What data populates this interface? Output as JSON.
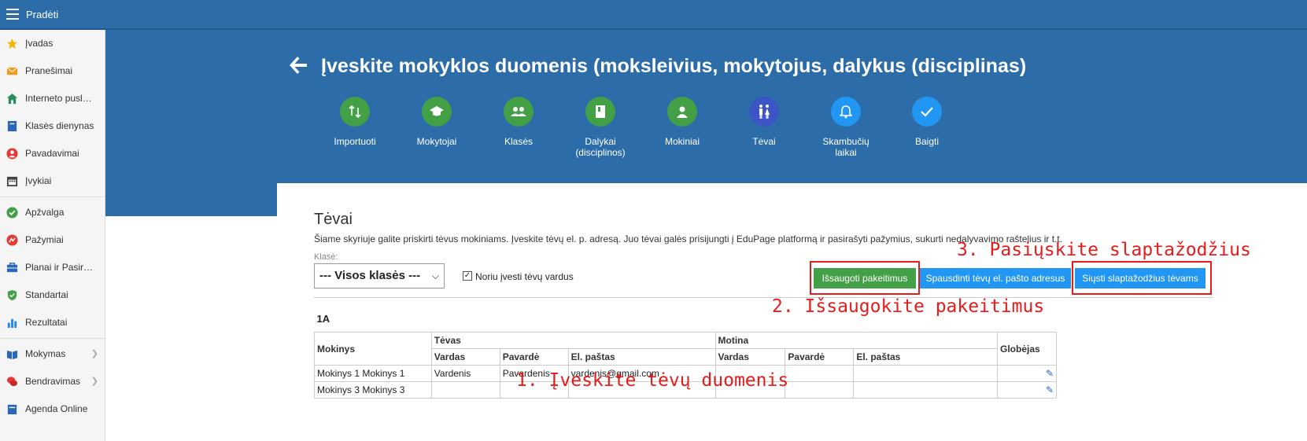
{
  "topbar": {
    "title": "Pradėti"
  },
  "sidebar": {
    "items": [
      {
        "label": "Įvadas",
        "icon": "star-icon",
        "color": "#f4b400"
      },
      {
        "label": "Pranešimai",
        "icon": "envelope-icon",
        "color": "#f29b1d"
      },
      {
        "label": "Interneto pusl…",
        "icon": "home-icon",
        "color": "#2a8b5c"
      },
      {
        "label": "Klasės dienynas",
        "icon": "book-icon",
        "color": "#2b67b8"
      },
      {
        "label": "Pavadavimai",
        "icon": "person-icon",
        "color": "#e53935"
      },
      {
        "label": "Įvykiai",
        "icon": "calendar-icon",
        "color": "#444444"
      },
      {
        "label": "Apžvalga",
        "icon": "check-circle-icon",
        "color": "#43a047"
      },
      {
        "label": "Pažymiai",
        "icon": "grade-icon",
        "color": "#e53935"
      },
      {
        "label": "Planai ir Pasir…",
        "icon": "briefcase-icon",
        "color": "#2b67b8"
      },
      {
        "label": "Standartai",
        "icon": "shield-icon",
        "color": "#43a047"
      },
      {
        "label": "Rezultatai",
        "icon": "bar-chart-icon",
        "color": "#1e88e5"
      },
      {
        "label": "Mokymas",
        "icon": "open-book-icon",
        "color": "#2b67b8"
      },
      {
        "label": "Bendravimas",
        "icon": "chat-icon",
        "color": "#e53935"
      },
      {
        "label": "Agenda Online",
        "icon": "agenda-icon",
        "color": "#2b67b8"
      }
    ]
  },
  "hero": {
    "title": "Įveskite mokyklos duomenis (moksleivius, mokytojus, dalykus (disciplinas)",
    "steps": [
      {
        "label": "Importuoti",
        "icon": "import-icon"
      },
      {
        "label": "Mokytojai",
        "icon": "graduation-cap-icon"
      },
      {
        "label": "Klasės",
        "icon": "group-icon"
      },
      {
        "label": "Dalykai (disciplinos)",
        "icon": "book-icon"
      },
      {
        "label": "Mokiniai",
        "icon": "person-icon"
      },
      {
        "label": "Tėvai",
        "icon": "parents-icon"
      },
      {
        "label": "Skambučių laikai",
        "icon": "bell-icon"
      },
      {
        "label": "Baigti",
        "icon": "check-icon"
      }
    ]
  },
  "section": {
    "title": "Tėvai",
    "description": "Šiame skyriuje galite priskirti tėvus mokiniams. Įveskite tėvų el. p. adresą. Juo tėvai galės prisijungti į EduPage platformą ir pasirašyti pažymius, sukurti nedalyvavimo raštelius ir t.t.",
    "class_label": "Klasė:",
    "class_select": "--- Visos klasės ---",
    "checkbox_label": "Noriu įvesti tėvų vardus",
    "checkbox_checked": true
  },
  "buttons": {
    "save": "Išsaugoti pakeitimus",
    "print": "Spausdinti tėvų el. pašto adresus",
    "send": "Siųsti slaptažodžius tėvams"
  },
  "annotations": {
    "step1": "1. Įveskite tėvų duomenis",
    "step2": "2. Išsaugokite pakeitimus",
    "step3": "3. Pasiųskite slaptažodžius"
  },
  "table": {
    "class_name": "1A",
    "col_student": "Mokinys",
    "group_father": "Tėvas",
    "group_mother": "Motina",
    "col_guardian": "Globėjas",
    "sub_first": "Vardas",
    "sub_last": "Pavardė",
    "sub_email": "El. paštas",
    "rows": [
      {
        "student": "Mokinys 1 Mokinys 1",
        "f_first": "Vardenis",
        "f_last": "Pavardenis",
        "f_email": "vardenis@gmail.com"
      },
      {
        "student": "Mokinys 3 Mokinys 3",
        "f_first": "",
        "f_last": "",
        "f_email": ""
      }
    ]
  }
}
